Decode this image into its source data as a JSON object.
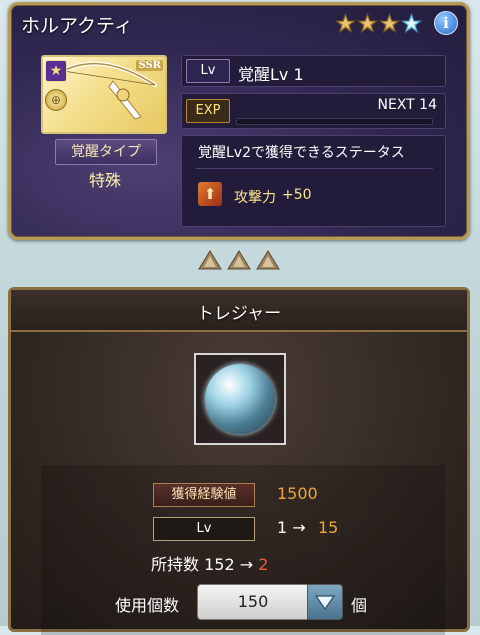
{
  "weapon": {
    "name": "ホルアクティ",
    "rarity_label": "SSR",
    "star_count": 4,
    "awaken_type_label": "覚醒タイプ",
    "awaken_type_value": "特殊",
    "lv_tag": "Lv",
    "lv_text": "覚醒Lv 1",
    "exp_tag": "EXP",
    "next_text": "NEXT 14",
    "exp_progress": 0.0,
    "status_title": "覚醒Lv2で獲得できるステータス",
    "atk_label": "攻撃力",
    "atk_value": "+50"
  },
  "treasure": {
    "title": "トレジャー",
    "exp_label": "獲得経験値",
    "exp_value": "1500",
    "lv_label": "Lv",
    "lv_from": "1 →",
    "lv_to": "15",
    "owned_prefix": "所持数 152 →",
    "owned_after": "2",
    "use_label": "使用個数",
    "use_value": "150",
    "use_unit": "個"
  },
  "colors": {
    "accent_orange": "#f1a33b",
    "accent_red": "#f05a3a",
    "panel_purple": "#2f2750",
    "panel_brown": "#342a25"
  }
}
